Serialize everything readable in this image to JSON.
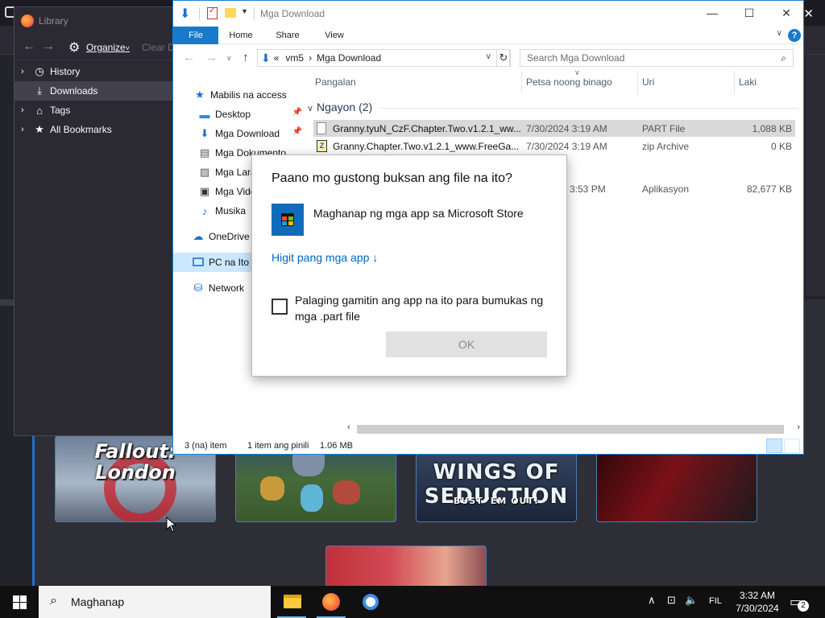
{
  "library": {
    "title": "Library",
    "organize_label": "Organize",
    "organize_arrow": "˅",
    "clear_label": "Clear D",
    "items": [
      {
        "label": "History"
      },
      {
        "label": "Downloads"
      },
      {
        "label": "Tags"
      },
      {
        "label": "All Bookmarks"
      }
    ]
  },
  "explorer": {
    "title": "Mga Download",
    "ribbon_tabs": [
      "File",
      "Home",
      "Share",
      "View"
    ],
    "help_label": "?",
    "address": {
      "prefix": "«",
      "segments": [
        "vm5",
        "Mga Download"
      ],
      "separator": "›"
    },
    "search_placeholder": "Search Mga Download",
    "nav": [
      {
        "label": "Mabilis na access"
      },
      {
        "label": "Desktop"
      },
      {
        "label": "Mga Download"
      },
      {
        "label": "Mga Dokumento"
      },
      {
        "label": "Mga Larawan"
      },
      {
        "label": "Mga Video"
      },
      {
        "label": "Musika"
      },
      {
        "label": "OneDrive"
      },
      {
        "label": "PC na Ito"
      },
      {
        "label": "Network"
      }
    ],
    "columns": [
      "Pangalan",
      "Petsa noong binago",
      "Uri",
      "Laki"
    ],
    "group": {
      "label": "Ngayon (2)"
    },
    "files": [
      {
        "name": "Granny.tyuN_CzF.Chapter.Two.v1.2.1_ww...",
        "date": "7/30/2024 3:19 AM",
        "type": "PART File",
        "size": "1,088 KB"
      },
      {
        "name": "Granny.Chapter.Two.v1.2.1_www.FreeGa...",
        "date": "7/30/2024 3:19 AM",
        "type": "zip Archive",
        "size": "0 KB"
      },
      {
        "name": "",
        "date": "3:53 PM",
        "type": "Aplikasyon",
        "size": "82,677 KB"
      }
    ],
    "status": {
      "count": "3 (na) item",
      "selected": "1 item ang pinili",
      "size": "1.06 MB"
    }
  },
  "dialog": {
    "title": "Paano mo gustong buksan ang file na ito?",
    "store_label": "Maghanap ng mga app sa Microsoft Store",
    "more_apps": "Higit pang mga app ↓",
    "always_use": "Palaging gamitin ang app na ito para bumukas ng mga .part file",
    "ok_label": "OK"
  },
  "background": {
    "tiles": [
      {
        "title": "Fallout: London"
      },
      {
        "title": ""
      },
      {
        "title": "WINGS OF SEDUCTION",
        "subtitle": "BUST 'EM OUT!"
      },
      {
        "title": ""
      },
      {
        "title": ""
      }
    ]
  },
  "taskbar": {
    "search_placeholder": "Maghanap",
    "language": "FIL",
    "time": "3:32 AM",
    "date": "7/30/2024",
    "notification_count": "2"
  },
  "colors": {
    "accent": "#1979ca",
    "taskbar": "#101010",
    "selection": "#cce8ff"
  }
}
